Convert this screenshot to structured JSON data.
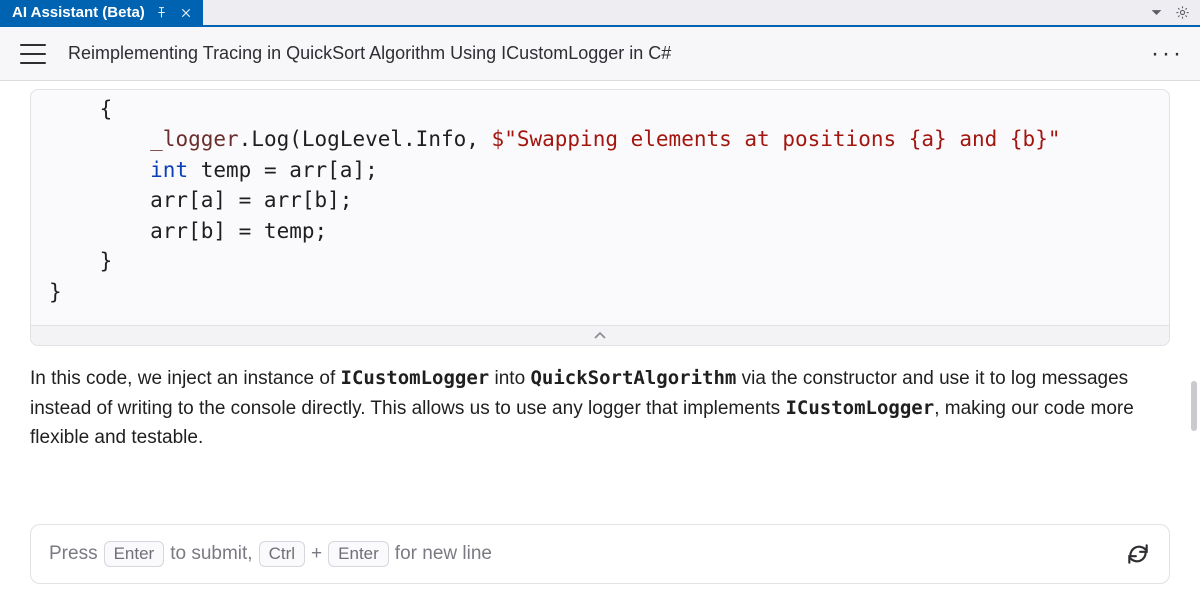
{
  "window": {
    "tab_title": "AI Assistant (Beta)"
  },
  "header": {
    "title": "Reimplementing Tracing in QuickSort Algorithm Using ICustomLogger in C#"
  },
  "code": {
    "line_tail_brace": "    {",
    "line_log_prefix": "        ",
    "line_log_field": "_logger",
    "line_log_mid": ".Log(LogLevel.Info, ",
    "line_log_str": "$\"Swapping elements at positions {a} and {b}\"",
    "line_temp_prefix": "        ",
    "line_temp_type": "int",
    "line_temp_rest": " temp = arr[a];",
    "line_swap1": "        arr[a] = arr[b];",
    "line_swap2": "        arr[b] = temp;",
    "line_closebrace1": "    }",
    "line_closebrace2": "}"
  },
  "explanation": {
    "p_a": "In this code, we inject an instance of ",
    "p_code1": "ICustomLogger",
    "p_b": " into ",
    "p_code2": "QuickSortAlgorithm",
    "p_c": " via the constructor and use it to log messages instead of writing to the console directly. This allows us to use any logger that implements ",
    "p_code3": "ICustomLogger",
    "p_d": ", making our code more flexible and testable."
  },
  "composer": {
    "ph_a": "Press",
    "key_enter": "Enter",
    "ph_b": "to submit,",
    "key_ctrl": "Ctrl",
    "ph_plus": "+",
    "key_enter2": "Enter",
    "ph_c": "for new line"
  }
}
